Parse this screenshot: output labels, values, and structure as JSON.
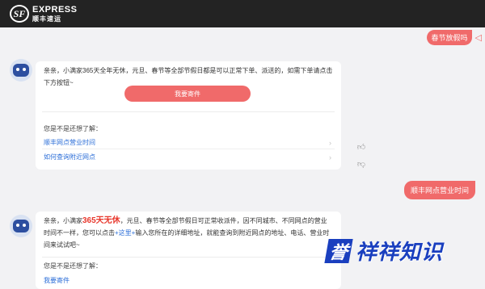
{
  "header": {
    "logo_mark": "SF",
    "logo_en": "EXPRESS",
    "logo_cn": "顺丰速运"
  },
  "conversation": {
    "user_msg_1": "春节放假吗",
    "bot_msg_1": {
      "text": "亲亲，小满家365天全年无休，元旦、春节等全部节假日都是可以正常下单、派送的，如需下单请点击下方按钮~",
      "button_label": "我要寄件",
      "prompt": "您是不是还想了解：",
      "suggestions": [
        "顺丰网点营业时间",
        "如何查询附近网点"
      ]
    },
    "user_msg_2": "顺丰网点营业时间",
    "bot_msg_2": {
      "text_before": "亲亲，小满家",
      "highlight": "365天无休",
      "text_middle": "，元旦、春节等全部节假日可正常收派件，因不同城市、不同网点的营业时间不一样，您可以点击",
      "link_text": "+这里+",
      "text_after": "输入您所在的详细地址，就能查询到附近网点的地址、电话、营业时间来试试吧~",
      "prompt": "您是不是还想了解：",
      "suggestions": [
        "我要寄件"
      ]
    }
  },
  "feedback": {
    "like_icon": "thumbs-up-icon",
    "dislike_icon": "thumbs-down-icon"
  },
  "watermark": {
    "badge": "誉",
    "text": "祥祥知识"
  }
}
